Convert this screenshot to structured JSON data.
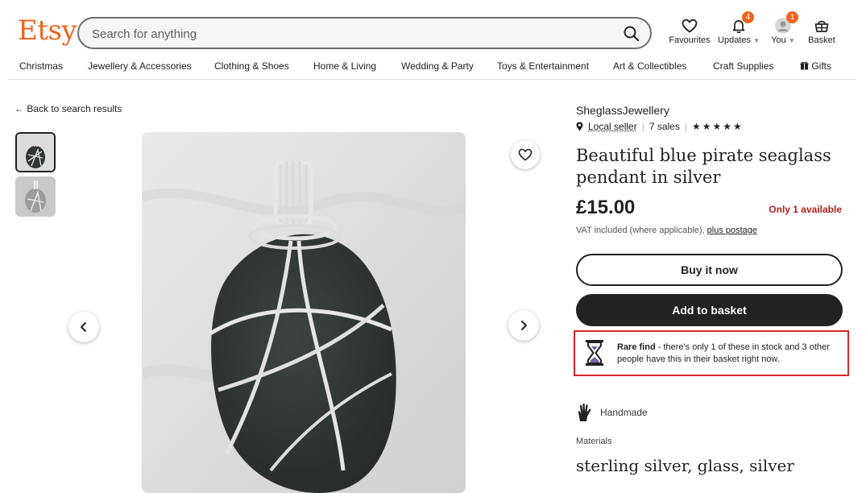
{
  "header": {
    "logo": "Etsy",
    "search_placeholder": "Search for anything",
    "favourites_label": "Favourites",
    "updates_label": "Updates",
    "updates_badge": "4",
    "you_label": "You",
    "you_badge": "1",
    "basket_label": "Basket",
    "accent_color": "#f1641e"
  },
  "nav": {
    "items": [
      "Christmas",
      "Jewellery & Accessories",
      "Clothing & Shoes",
      "Home & Living",
      "Wedding & Party",
      "Toys & Entertainment",
      "Art & Collectibles",
      "Craft Supplies",
      "Gifts"
    ]
  },
  "gallery": {
    "back_label": "← Back to search results"
  },
  "listing": {
    "shop_name": "SheglassJewellery",
    "local_seller": "Local seller",
    "sales": "7 sales",
    "stars": "★★★★★",
    "title": "Beautiful blue pirate seaglass pendant in silver",
    "price": "£15.00",
    "availability": "Only 1 available",
    "vat_text": "VAT included (where applicable), ",
    "postage_link": "plus postage",
    "buy_now": "Buy it now",
    "add_to_basket": "Add to basket",
    "rare_bold": "Rare find",
    "rare_text": " - there's only 1 of these in stock and 3 other people have this in their basket right now.",
    "handmade": "Handmade",
    "materials_label": "Materials",
    "materials": "sterling silver, glass, silver",
    "availability_color": "#b4211a",
    "highlight_color": "#d7262b"
  }
}
